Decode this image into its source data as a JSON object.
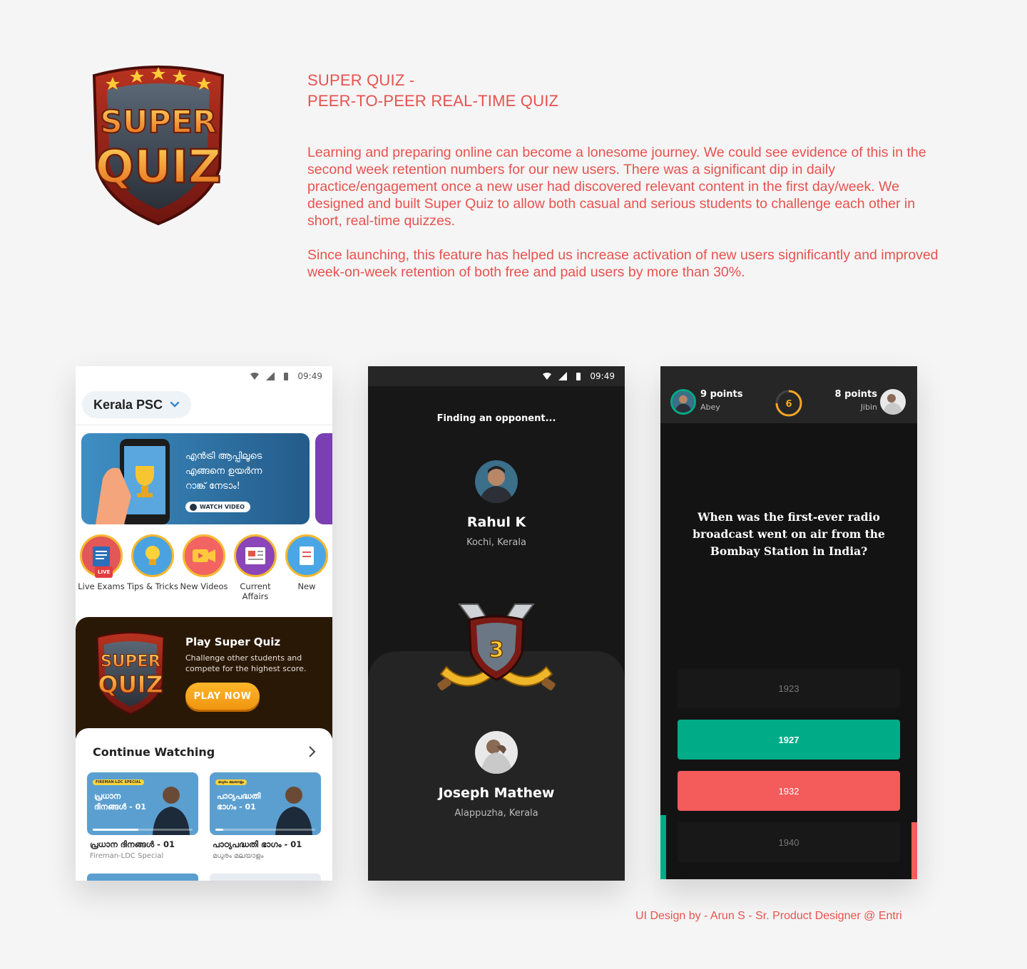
{
  "header": {
    "title_line1": "SUPER QUIZ -",
    "title_line2": "PEER-TO-PEER REAL-TIME QUIZ",
    "paragraph1": "Learning and preparing online can become a lonesome journey. We could see evidence of this in the second week retention numbers for our new users. There was a significant dip in daily practice/engagement once a new user had discovered relevant content in the first day/week. We designed and built Super Quiz to allow both casual and serious students to challenge each other in short, real-time quizzes.",
    "paragraph2": "Since launching, this feature has helped us increase activation of new users significantly and improved week-on-week retention of both free and paid users by more than 30%.",
    "credit": "UI Design by - Arun S - Sr. Product Designer @ Entri"
  },
  "logo": {
    "line1": "SUPER",
    "line2": "QUIZ"
  },
  "colors": {
    "accent": "#e8524f",
    "correct": "#00ab87",
    "wrong": "#f45b5b",
    "timer": "#f5a623"
  },
  "phone1": {
    "time": "09:49",
    "course_selector": "Kerala PSC",
    "banner": {
      "line1": "എൻട്രി ആപ്പിലൂടെ",
      "line2": "എങ്ങനെ ഉയർന്ന",
      "line3": "റാങ്ക് നേടാം!",
      "button": "WATCH VIDEO"
    },
    "categories": [
      {
        "label": "Live Exams",
        "icon": "exam-icon",
        "tag": "LIVE"
      },
      {
        "label": "Tips & Tricks",
        "icon": "bulb-icon"
      },
      {
        "label": "New Videos",
        "icon": "video-camera-icon"
      },
      {
        "label": "Current Affairs",
        "icon": "news-icon"
      },
      {
        "label": "New",
        "icon": "checklist-icon"
      }
    ],
    "super_quiz_card": {
      "title": "Play Super Quiz",
      "subtitle": "Challenge other students and compete for the highest score.",
      "button": "PLAY NOW"
    },
    "continue_watching": {
      "title": "Continue Watching",
      "videos": [
        {
          "tag": "FIREMAN-LDC SPECIAL",
          "thumb_text": "പ്രധാന ദിനങ്ങൾ - 01",
          "title": "പ്രധാന ദിനങ്ങൾ - 01",
          "subtitle": "Fireman-LDC Special",
          "progress": 0.46
        },
        {
          "tag": "മധുരം മലയാളം",
          "thumb_text": "പാഠ്യപദ്ധതി ഭാഗം - 01",
          "title": "പാഠ്യപദ്ധതി ഭാഗം - 01",
          "subtitle": "മധുരം മലയാളം",
          "progress": 0.08
        }
      ]
    }
  },
  "phone2": {
    "time": "09:49",
    "status": "Finding an opponent...",
    "player1": {
      "name": "Rahul K",
      "location": "Kochi, Kerala"
    },
    "player2": {
      "name": "Joseph Mathew",
      "location": "Alappuzha, Kerala"
    },
    "countdown": "3"
  },
  "phone3": {
    "left_player": {
      "points": "9 points",
      "name": "Abey"
    },
    "right_player": {
      "points": "8 points",
      "name": "Jibin"
    },
    "timer": "6",
    "question": "When was the first-ever radio broadcast went on air from the Bombay Station in India?",
    "options": [
      "1923",
      "1927",
      "1932",
      "1940"
    ]
  }
}
